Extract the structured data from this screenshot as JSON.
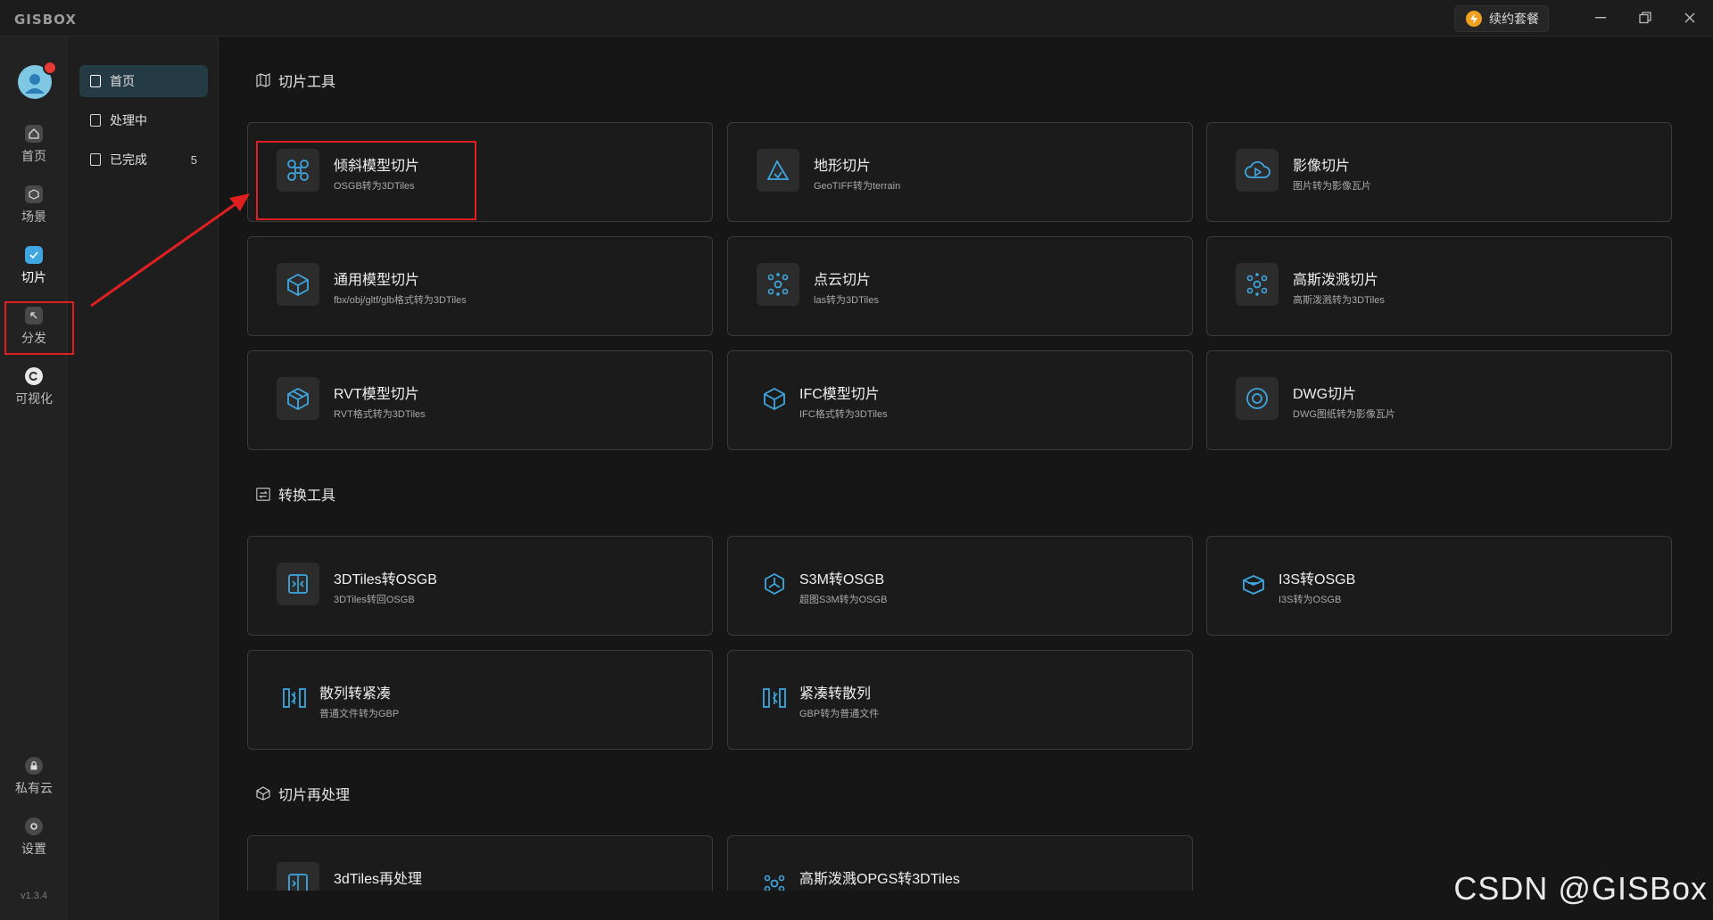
{
  "app": {
    "logo": "GISBOX",
    "renew_label": "续约套餐",
    "version": "v1.3.4",
    "watermark": "CSDN @GISBox"
  },
  "rail": {
    "items": [
      {
        "label": "首页",
        "icon": "home-icon"
      },
      {
        "label": "场景",
        "icon": "scene-icon"
      },
      {
        "label": "切片",
        "icon": "tile-icon",
        "active": true
      },
      {
        "label": "分发",
        "icon": "publish-icon"
      },
      {
        "label": "可视化",
        "icon": "visualization-icon"
      }
    ],
    "bottom_items": [
      {
        "label": "私有云",
        "icon": "lock-icon"
      },
      {
        "label": "设置",
        "icon": "gear-icon"
      }
    ]
  },
  "subnav": {
    "items": [
      {
        "label": "首页",
        "active": true
      },
      {
        "label": "处理中"
      },
      {
        "label": "已完成",
        "count": "5"
      }
    ]
  },
  "sections": [
    {
      "title": "切片工具",
      "cards": [
        {
          "title": "倾斜模型切片",
          "sub": "OSGB转为3DTiles",
          "icon": "drone-icon"
        },
        {
          "title": "地形切片",
          "sub": "GeoTIFF转为terrain",
          "icon": "terrain-icon"
        },
        {
          "title": "影像切片",
          "sub": "图片转为影像瓦片",
          "icon": "cloud-play-icon"
        },
        {
          "title": "通用模型切片",
          "sub": "fbx/obj/gltf/glb格式转为3DTiles",
          "icon": "cube-icon"
        },
        {
          "title": "点云切片",
          "sub": "las转为3DTiles",
          "icon": "point-cloud-icon"
        },
        {
          "title": "高斯泼溅切片",
          "sub": "高斯泼溅转为3DTiles",
          "icon": "gaussian-icon"
        },
        {
          "title": "RVT模型切片",
          "sub": "RVT格式转为3DTiles",
          "icon": "rvt-cube-icon"
        },
        {
          "title": "IFC模型切片",
          "sub": "IFC格式转为3DTiles",
          "icon": "ifc-cube-icon"
        },
        {
          "title": "DWG切片",
          "sub": "DWG图纸转为影像瓦片",
          "icon": "dwg-circle-icon"
        }
      ]
    },
    {
      "title": "转换工具",
      "cards": [
        {
          "title": "3DTiles转OSGB",
          "sub": "3DTiles转回OSGB",
          "icon": "convert-icon"
        },
        {
          "title": "S3M转OSGB",
          "sub": "超图S3M转为OSGB",
          "icon": "hexagon-icon"
        },
        {
          "title": "I3S转OSGB",
          "sub": "I3S转为OSGB",
          "icon": "box-open-icon"
        },
        {
          "title": "散列转紧凑",
          "sub": "普通文件转为GBP",
          "icon": "scatter-compact-icon"
        },
        {
          "title": "紧凑转散列",
          "sub": "GBP转为普通文件",
          "icon": "compact-scatter-icon"
        }
      ]
    },
    {
      "title": "切片再处理",
      "cards": [
        {
          "title": "3dTiles再处理",
          "sub": "",
          "icon": "reprocess-icon"
        },
        {
          "title": "高斯泼溅OPGS转3DTiles",
          "sub": "",
          "icon": "gaussian-convert-icon"
        }
      ]
    }
  ],
  "colors": {
    "accent": "#3fa6e0",
    "annotation_red": "#e02020",
    "background": "#161616"
  }
}
